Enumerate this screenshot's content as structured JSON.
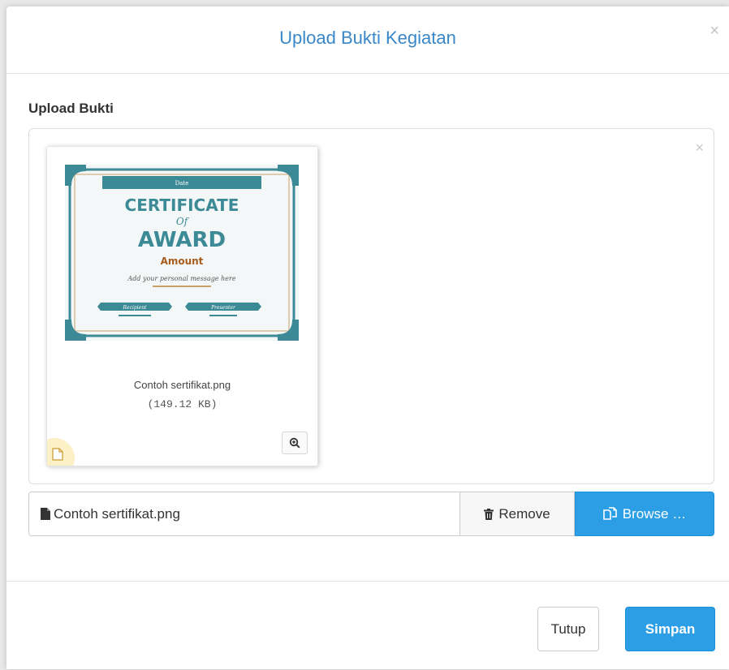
{
  "modal": {
    "title": "Upload Bukti Kegiatan",
    "close_symbol": "×"
  },
  "form": {
    "label": "Upload Bukti"
  },
  "preview": {
    "close_symbol": "×",
    "file_name": "Contoh sertifikat.png",
    "file_size": "(149.12 KB)",
    "certificate": {
      "header": "Date",
      "line1": "CERTIFICATE",
      "line2": "Of",
      "line3": "AWARD",
      "line4": "Amount",
      "message": "Add your personal message here",
      "left_tag": "Recipient",
      "right_tag": "Presenter"
    }
  },
  "file_input": {
    "caption": "Contoh sertifikat.png",
    "remove_label": "Remove",
    "browse_label": "Browse …"
  },
  "footer": {
    "close_label": "Tutup",
    "save_label": "Simpan"
  },
  "colors": {
    "primary": "#2c9ee6",
    "title": "#3a87c8",
    "teal": "#3b8a96"
  }
}
